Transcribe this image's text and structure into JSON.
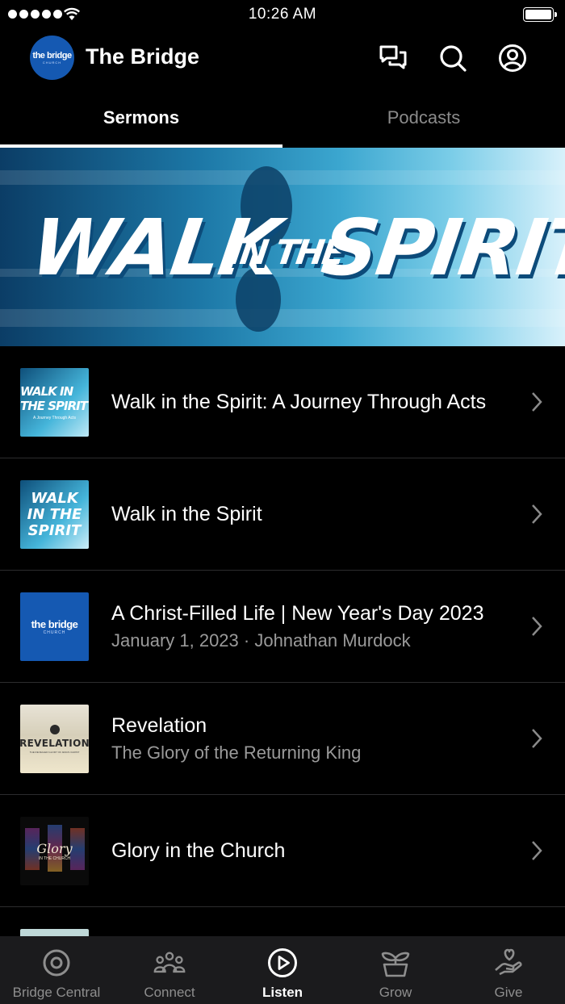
{
  "status_bar": {
    "time": "10:26 AM"
  },
  "header": {
    "logo_text": "the bridge",
    "logo_subtext": "CHURCH",
    "title": "The Bridge"
  },
  "tabs": [
    {
      "label": "Sermons",
      "active": true
    },
    {
      "label": "Podcasts",
      "active": false
    }
  ],
  "banner": {
    "word1": "WALK",
    "word2": "IN THE",
    "word3": "SPIRIT"
  },
  "sermons": [
    {
      "title": "Walk in the Spirit: A Journey Through Acts",
      "subtitle": "",
      "thumb_text": "WALK IN THE SPIRIT",
      "thumb_sub": "A Journey Through Acts"
    },
    {
      "title": "Walk in the Spirit",
      "subtitle": "",
      "thumb_text": "WALK IN THE SPIRIT"
    },
    {
      "title": "A Christ-Filled Life | New Year's Day 2023",
      "subtitle": "January 1, 2023 · Johnathan Murdock",
      "thumb_text": "the bridge",
      "thumb_sub": "CHURCH"
    },
    {
      "title": "Revelation",
      "subtitle": "The Glory of the Returning King",
      "thumb_text": "REVELATION",
      "thumb_sub": "THE REVEALED GLORY OF JESUS CHRIST"
    },
    {
      "title": "Glory in the Church",
      "subtitle": "",
      "thumb_text": "Glory",
      "thumb_sub": "IN THE CHURCH"
    }
  ],
  "bottom_nav": [
    {
      "label": "Bridge Central",
      "icon": "target-icon",
      "active": false
    },
    {
      "label": "Connect",
      "icon": "people-icon",
      "active": false
    },
    {
      "label": "Listen",
      "icon": "play-circle-icon",
      "active": true
    },
    {
      "label": "Grow",
      "icon": "sprout-icon",
      "active": false
    },
    {
      "label": "Give",
      "icon": "heart-hand-icon",
      "active": false
    }
  ],
  "colors": {
    "background": "#000000",
    "brand": "#1559b2",
    "nav_bg": "#1b1b1d",
    "muted": "#8e8e8e"
  }
}
